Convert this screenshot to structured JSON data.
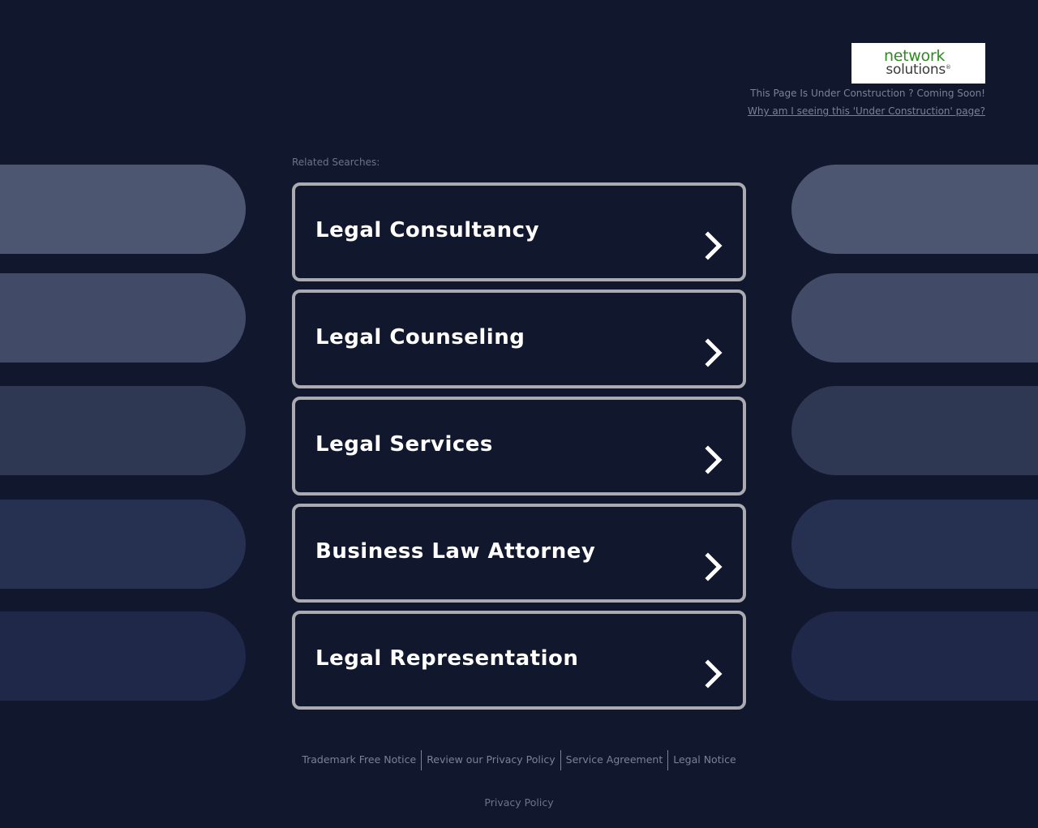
{
  "colors": {
    "background": "#11172c",
    "card_border": "#a9abb0",
    "pill_shades": [
      "#4c5671",
      "#414a67",
      "#2f3853",
      "#263051",
      "#1f2848"
    ],
    "logo_green": "#2e8b22"
  },
  "header": {
    "logo_line1": "network",
    "logo_line2": "solutions",
    "logo_mark": "®",
    "under_construction": "This Page Is Under Construction ? Coming Soon!",
    "why_link": "Why am I seeing this 'Under Construction' page?"
  },
  "related": {
    "label": "Related Searches:",
    "items": [
      {
        "label": "Legal Consultancy",
        "icon": "chevron-right-icon"
      },
      {
        "label": "Legal Counseling",
        "icon": "chevron-right-icon"
      },
      {
        "label": "Legal Services",
        "icon": "chevron-right-icon"
      },
      {
        "label": "Business Law Attorney",
        "icon": "chevron-right-icon"
      },
      {
        "label": "Legal Representation",
        "icon": "chevron-right-icon"
      }
    ]
  },
  "footer": {
    "links": [
      "Trademark Free Notice",
      "Review our Privacy Policy",
      "Service Agreement",
      "Legal Notice"
    ],
    "privacy": "Privacy Policy"
  }
}
